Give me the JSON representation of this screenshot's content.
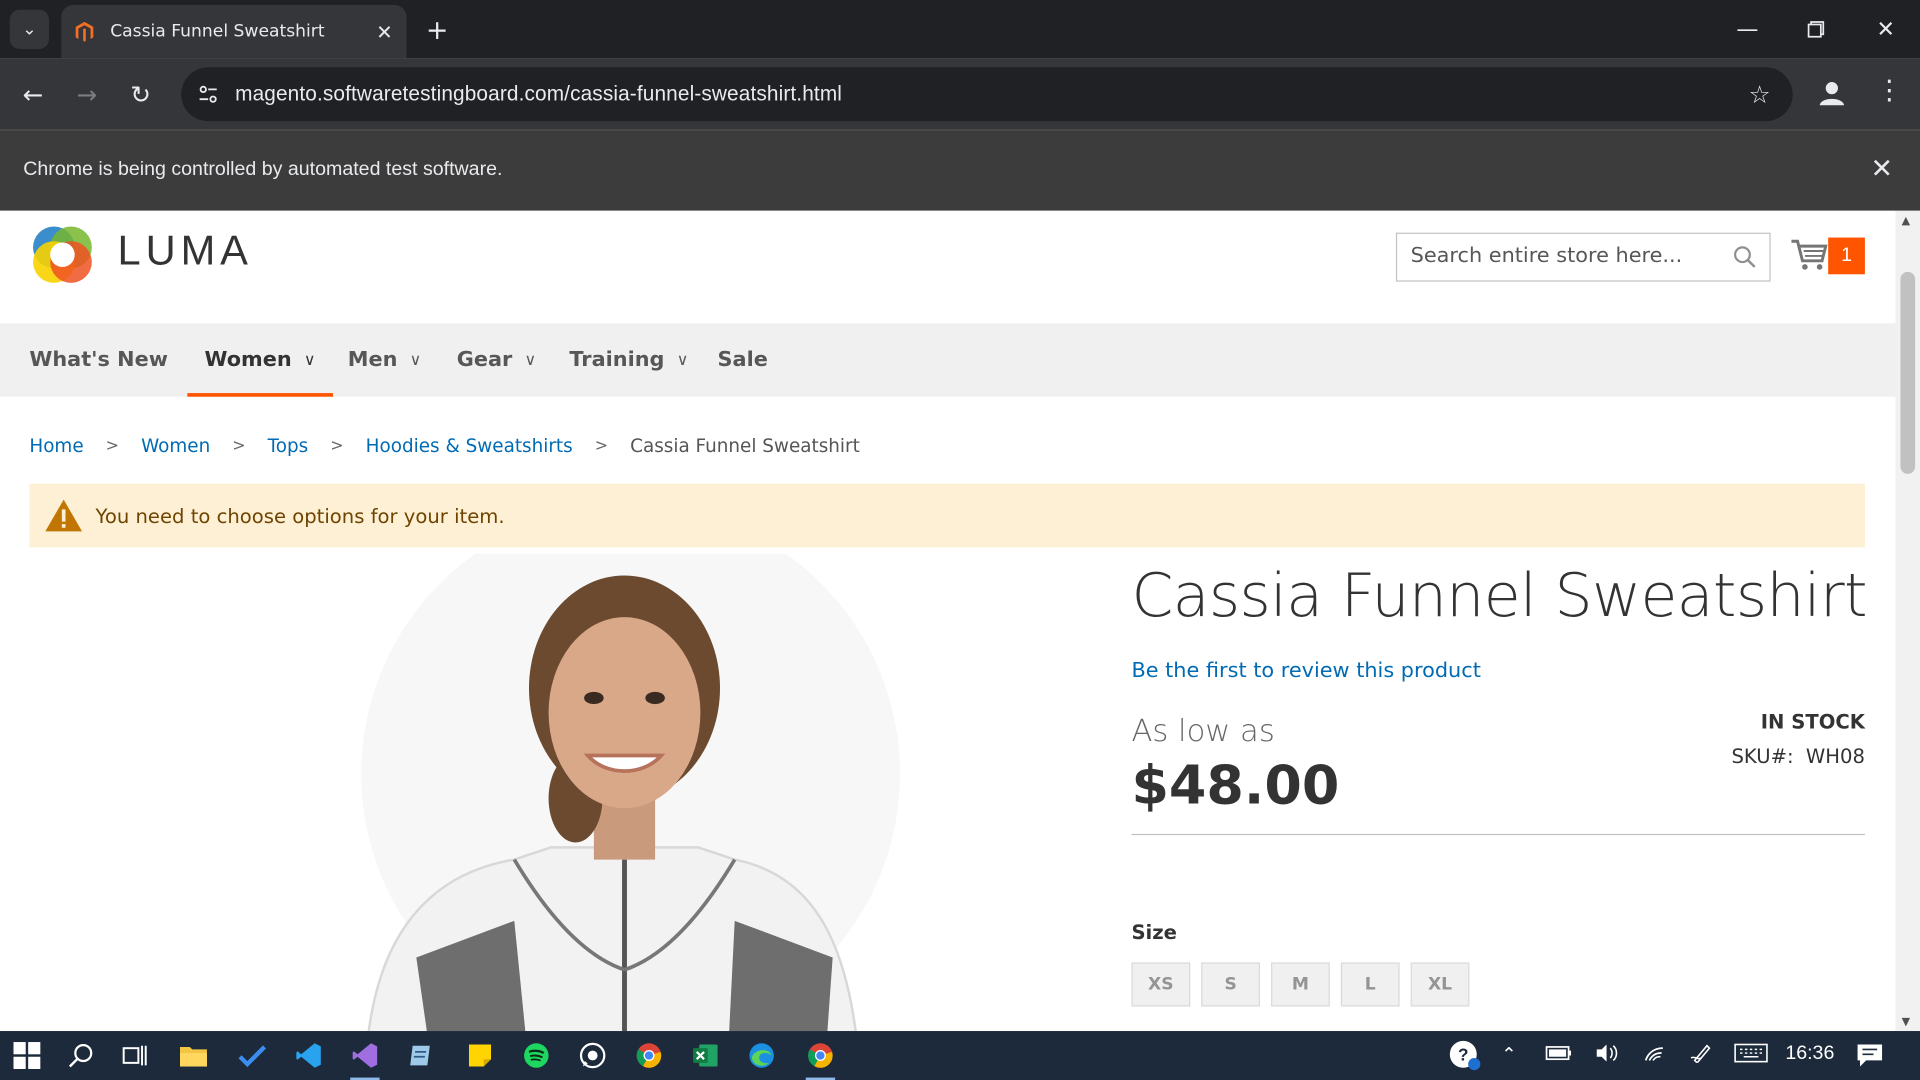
{
  "browser": {
    "tab_title": "Cassia Funnel Sweatshirt",
    "url": "magento.softwaretestingboard.com/cassia-funnel-sweatshirt.html",
    "infobar_message": "Chrome is being controlled by automated test software."
  },
  "header": {
    "logo_text": "LUMA",
    "search_placeholder": "Search entire store here...",
    "cart_count": "1"
  },
  "nav": {
    "items": [
      {
        "label": "What's New"
      },
      {
        "label": "Women"
      },
      {
        "label": "Men"
      },
      {
        "label": "Gear"
      },
      {
        "label": "Training"
      },
      {
        "label": "Sale"
      }
    ],
    "active": "Women"
  },
  "breadcrumb": {
    "items": [
      "Home",
      "Women",
      "Tops",
      "Hoodies & Sweatshirts"
    ],
    "current": "Cassia Funnel Sweatshirt"
  },
  "notice": {
    "text": "You need to choose options for your item."
  },
  "product": {
    "title": "Cassia Funnel Sweatshirt",
    "review_link": "Be the first to review this product",
    "price_prefix": "As low as",
    "price": "$48.00",
    "stock": "IN STOCK",
    "sku_label": "SKU#:",
    "sku_value": "WH08",
    "size_label": "Size",
    "sizes": [
      "XS",
      "S",
      "M",
      "L",
      "XL"
    ]
  },
  "taskbar": {
    "clock": "16:36"
  },
  "colors": {
    "accent": "#ff5501",
    "link": "#006bb4",
    "notice_bg": "#fdf0d5"
  }
}
